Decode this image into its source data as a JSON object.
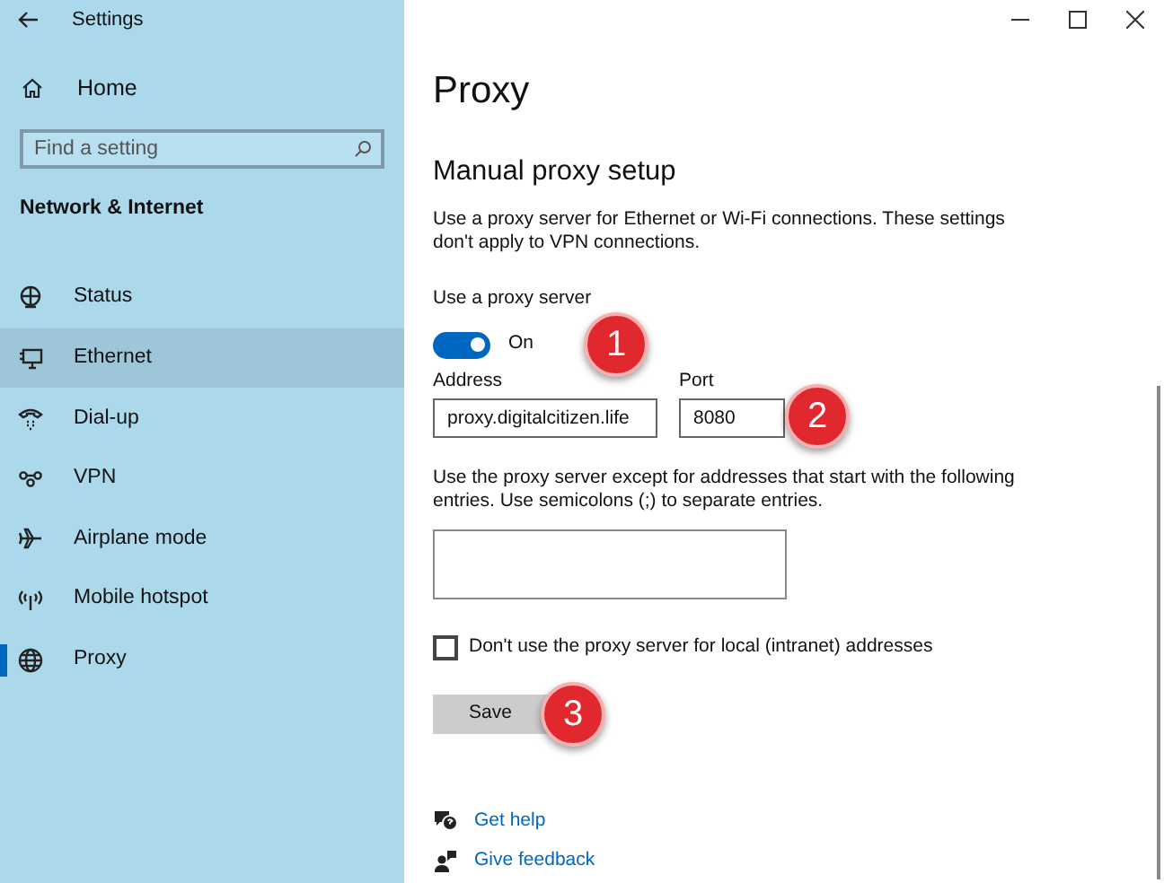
{
  "window": {
    "title": "Settings"
  },
  "sidebar": {
    "home": "Home",
    "search": {
      "placeholder": "Find a setting"
    },
    "section": "Network & Internet",
    "items": [
      {
        "label": "Status",
        "kind": "status",
        "selected": false,
        "highlighted": false
      },
      {
        "label": "Ethernet",
        "kind": "ethernet",
        "selected": false,
        "highlighted": true
      },
      {
        "label": "Dial-up",
        "kind": "dialup",
        "selected": false,
        "highlighted": false
      },
      {
        "label": "VPN",
        "kind": "vpn",
        "selected": false,
        "highlighted": false
      },
      {
        "label": "Airplane mode",
        "kind": "airplane",
        "selected": false,
        "highlighted": false
      },
      {
        "label": "Mobile hotspot",
        "kind": "hotspot",
        "selected": false,
        "highlighted": false
      },
      {
        "label": "Proxy",
        "kind": "globe",
        "selected": true,
        "highlighted": false
      }
    ]
  },
  "main": {
    "title": "Proxy",
    "section": "Manual proxy setup",
    "description": "Use a proxy server for Ethernet or Wi-Fi connections. These settings don't apply to VPN connections.",
    "toggle": {
      "label": "Use a proxy server",
      "on": true,
      "state_text": "On"
    },
    "address": {
      "label": "Address",
      "value": "proxy.digitalcitizen.life"
    },
    "port": {
      "label": "Port",
      "value": "8080"
    },
    "exceptions": {
      "label": "Use the proxy server except for addresses that start with the following entries. Use semicolons (;) to separate entries."
    },
    "local_checkbox": {
      "label": "Don't use the proxy server for local (intranet) addresses",
      "checked": false
    },
    "save": "Save",
    "links": [
      {
        "label": "Get help",
        "kind": "help"
      },
      {
        "label": "Give feedback",
        "kind": "feedback"
      }
    ]
  },
  "annotations": [
    "1",
    "2",
    "3"
  ]
}
